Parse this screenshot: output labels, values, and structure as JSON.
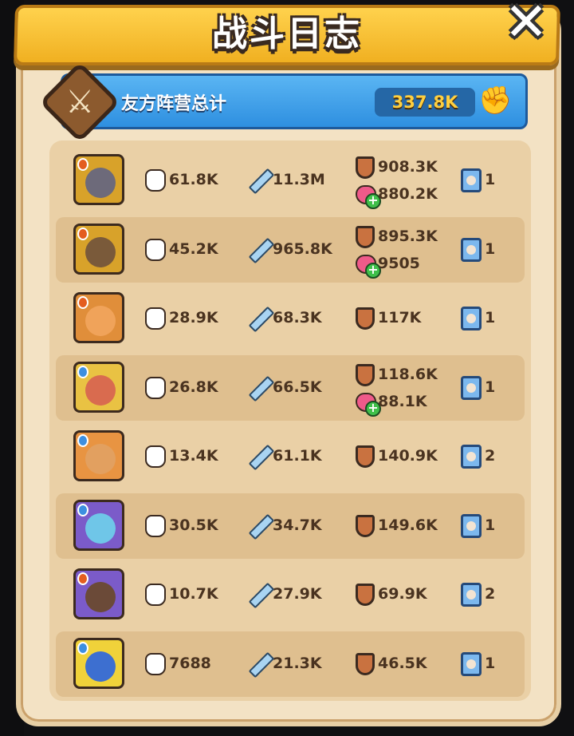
{
  "header": {
    "title": "战斗日志",
    "close_icon": "close-icon"
  },
  "summary": {
    "label": "友方阵营总计",
    "value": "337.8K",
    "badge_icon": "crossed-swords-icon",
    "value_icon": "fist-icon"
  },
  "colors": {
    "accent": "#f0b021",
    "summary_bg": "#2e8fe0",
    "value_text": "#ffcf3f",
    "stat_text": "#4a3320"
  },
  "rows": [
    {
      "power": "61.8K",
      "damage": "11.3M",
      "defense": "908.3K",
      "heal": "880.2K",
      "count": "1",
      "element": "fire"
    },
    {
      "power": "45.2K",
      "damage": "965.8K",
      "defense": "895.3K",
      "heal": "9505",
      "count": "1",
      "element": "fire"
    },
    {
      "power": "28.9K",
      "damage": "68.3K",
      "defense": "117K",
      "heal": "",
      "count": "1",
      "element": "fire"
    },
    {
      "power": "26.8K",
      "damage": "66.5K",
      "defense": "118.6K",
      "heal": "88.1K",
      "count": "1",
      "element": "water"
    },
    {
      "power": "13.4K",
      "damage": "61.1K",
      "defense": "140.9K",
      "heal": "",
      "count": "2",
      "element": "water"
    },
    {
      "power": "30.5K",
      "damage": "34.7K",
      "defense": "149.6K",
      "heal": "",
      "count": "1",
      "element": "water"
    },
    {
      "power": "10.7K",
      "damage": "27.9K",
      "defense": "69.9K",
      "heal": "",
      "count": "2",
      "element": "fire"
    },
    {
      "power": "7688",
      "damage": "21.3K",
      "defense": "46.5K",
      "heal": "",
      "count": "1",
      "element": "water"
    }
  ]
}
